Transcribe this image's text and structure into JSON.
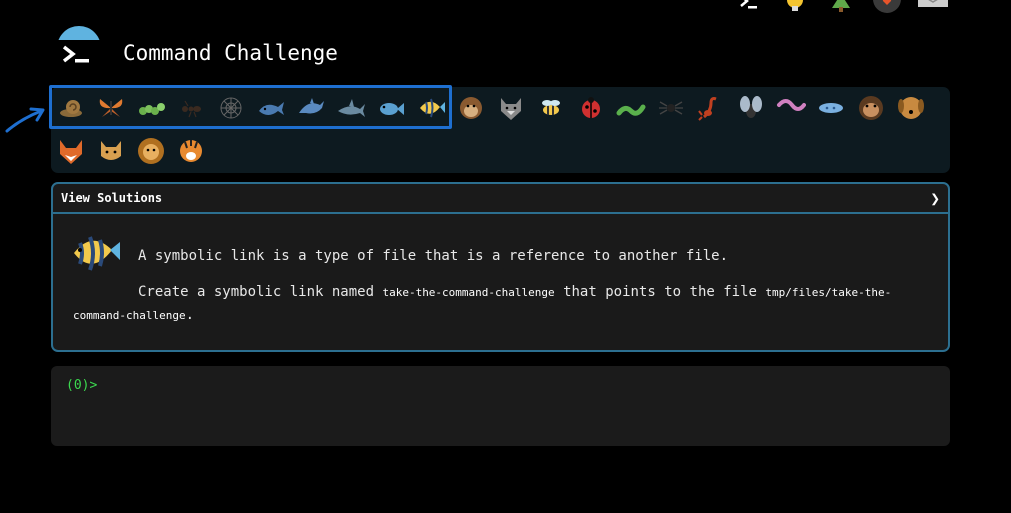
{
  "app": {
    "title": "Command Challenge"
  },
  "header_icons": [
    "terminal-icon",
    "bulb-icon",
    "tree-icon",
    "shield-icon",
    "mail-icon"
  ],
  "animals": [
    "snail",
    "butterfly",
    "caterpillar",
    "ant",
    "spider-web",
    "whale",
    "dolphin",
    "shark",
    "fish",
    "tropical-fish",
    "monkey",
    "wolf",
    "bee",
    "ladybug",
    "worm",
    "spider",
    "scorpion",
    "fly",
    "earthworm",
    "paramecium",
    "chimpanzee",
    "dog",
    "fox",
    "cat",
    "lion",
    "tiger"
  ],
  "challenge": {
    "toggle_label": "View Solutions",
    "toggle_icon": "chevron-right-icon",
    "description": "A symbolic link is a type of file that is a reference to another file.",
    "instruction_prefix": "Create a symbolic link named",
    "link_name": "take-the-command-challenge",
    "instruction_middle": "that points to the file",
    "target_path": "tmp/files/take-the-command-challenge",
    "instruction_suffix": "."
  },
  "terminal": {
    "prompt": "(0)>"
  },
  "colors": {
    "background": "#000000",
    "panel": "#0d1a20",
    "challenge_border": "#2c6f90",
    "highlight": "#1e6fd0",
    "prompt_green": "#3cd94f"
  }
}
